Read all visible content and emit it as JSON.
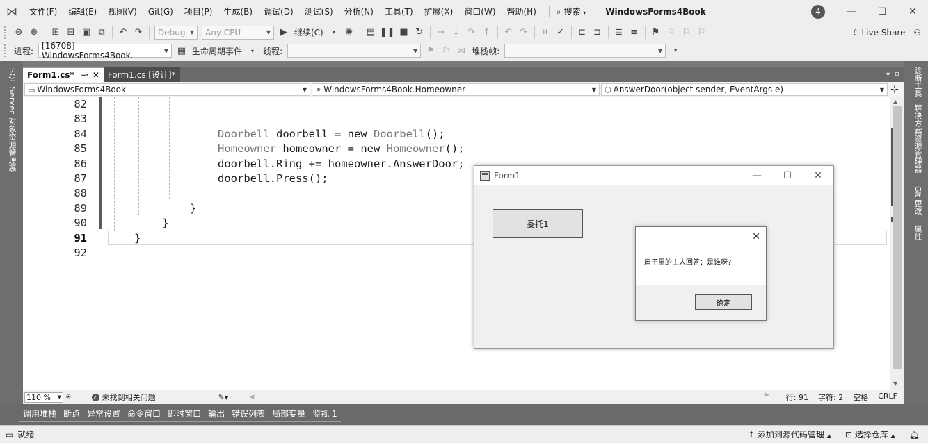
{
  "menubar": {
    "items": [
      "文件(F)",
      "编辑(E)",
      "视图(V)",
      "Git(G)",
      "项目(P)",
      "生成(B)",
      "调试(D)",
      "测试(S)",
      "分析(N)",
      "工具(T)",
      "扩展(X)",
      "窗口(W)",
      "帮助(H)"
    ],
    "search_label": "搜索",
    "title": "WindowsForms4Book",
    "notification_count": "4"
  },
  "toolbar1": {
    "config": "Debug",
    "platform": "Any CPU",
    "continue_label": "继续(C)",
    "live_share": "Live Share"
  },
  "toolbar2": {
    "process_label": "进程:",
    "process_value": "[16708] WindowsForms4Book.",
    "lifecycle_label": "生命周期事件",
    "thread_label": "线程:",
    "stackframe_label": "堆栈帧:"
  },
  "left_rail": {
    "label": "SQL Server 对象资源管理器"
  },
  "right_rail": {
    "labels": [
      "诊断工具",
      "解决方案资源管理器",
      "Git 更改",
      "属性"
    ]
  },
  "tabs": [
    {
      "label": "Form1.cs*",
      "active": true
    },
    {
      "label": "Form1.cs [设计]*",
      "active": false
    }
  ],
  "navbar": {
    "project": "WindowsForms4Book",
    "type": "WindowsForms4Book.Homeowner",
    "member": "AnswerDoor(object sender, EventArgs e)"
  },
  "editor": {
    "line_numbers": [
      "82",
      "83",
      "84",
      "85",
      "86",
      "87",
      "88",
      "89",
      "90",
      "91",
      "92"
    ],
    "current_line": "91",
    "code_lines": {
      "l84": {
        "type": "Doorbell",
        "rest": " doorbell = new ",
        "type2": "Doorbell",
        "end": "();"
      },
      "l85": {
        "type": "Homeowner",
        "rest": " homeowner = new ",
        "type2": "Homeowner",
        "end": "();"
      },
      "l86": "doorbell.Ring += homeowner.AnswerDoor;",
      "l87": "doorbell.Press();",
      "l89": "}",
      "l90": "}",
      "l91": "}"
    }
  },
  "editor_status": {
    "zoom": "110 %",
    "issues": "未找到相关问题",
    "line": "行: 91",
    "char": "字符: 2",
    "whitespace": "空格",
    "eol": "CRLF"
  },
  "tool_tabs": [
    "调用堆栈",
    "断点",
    "异常设置",
    "命令窗口",
    "即时窗口",
    "输出",
    "错误列表",
    "局部变量",
    "监视 1"
  ],
  "statusbar": {
    "ready": "就绪",
    "source_control": "添加到源代码管理",
    "repo": "选择仓库"
  },
  "form1": {
    "title": "Form1",
    "button_label": "委托1"
  },
  "msgbox": {
    "message": "屋子里的主人回答：是谁呀?",
    "ok_label": "确定"
  }
}
